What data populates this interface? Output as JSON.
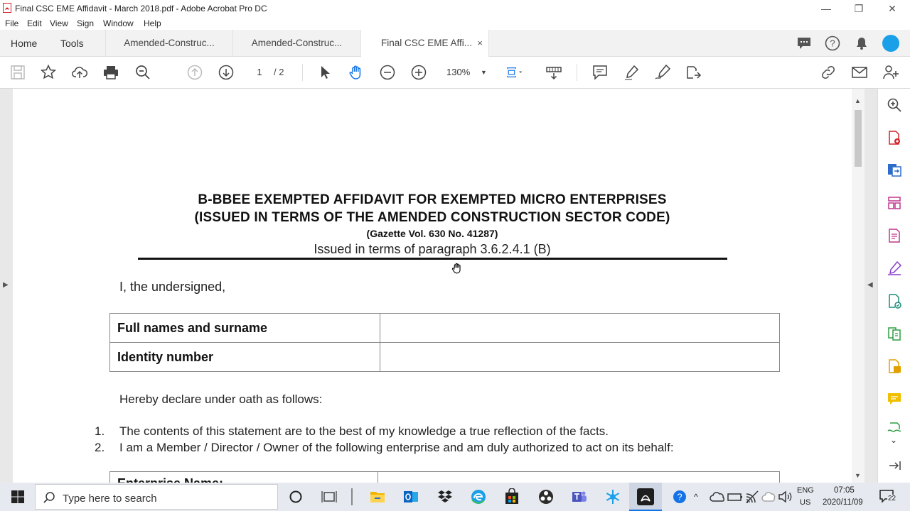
{
  "window": {
    "title": "Final CSC EME Affidavit - March 2018.pdf - Adobe Acrobat Pro DC"
  },
  "menu": [
    "File",
    "Edit",
    "View",
    "Sign",
    "Window",
    "Help"
  ],
  "tabs": {
    "home": "Home",
    "tools": "Tools",
    "docs": [
      "Amended-Construc...",
      "Amended-Construc...",
      "Final CSC EME Affi..."
    ],
    "close": "×"
  },
  "toolbar": {
    "page_current": "1",
    "page_total": "/ 2",
    "zoom": "130%"
  },
  "document": {
    "title_line1": "B-BBEE EXEMPTED AFFIDAVIT FOR EXEMPTED MICRO ENTERPRISES",
    "title_line2": "(ISSUED IN TERMS OF THE AMENDED CONSTRUCTION SECTOR CODE)",
    "gazette": "(Gazette Vol. 630 No. 41287)",
    "paragraph_ref": "Issued in terms of paragraph 3.6.2.4.1 (B)",
    "intro": "I, the undersigned,",
    "fields": [
      {
        "label": "Full names and surname",
        "value": ""
      },
      {
        "label": "Identity number",
        "value": ""
      }
    ],
    "declare": "Hereby declare under oath as follows:",
    "items": [
      {
        "num": "1.",
        "text": "The contents of this statement are to the best of my knowledge a true reflection of the facts."
      },
      {
        "num": "2.",
        "text": "I am a Member / Director / Owner of the following enterprise and am duly authorized to act on its behalf:"
      }
    ],
    "enterprise_label": "Enterprise Name:"
  },
  "taskbar": {
    "search_placeholder": "Type here to search",
    "lang_line1": "ENG",
    "lang_line2": "US",
    "time": "07:05",
    "date": "2020/11/09",
    "notification_count": "22"
  },
  "colors": {
    "acrobat_red": "#d2232a",
    "accent_blue": "#1473e6",
    "avatar_blue": "#1aa0e8"
  }
}
